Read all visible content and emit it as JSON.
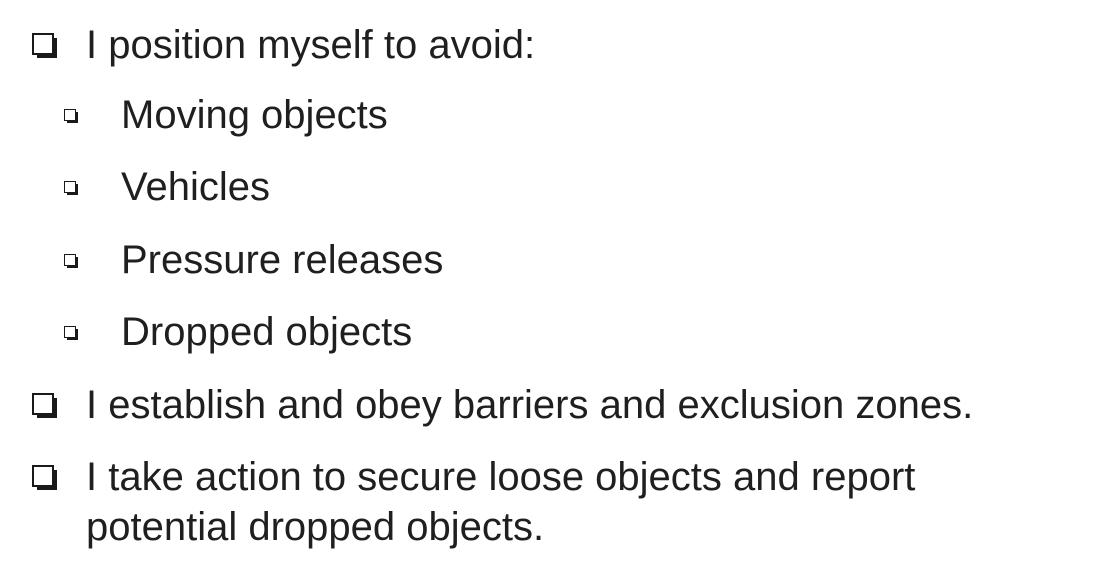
{
  "bullets": [
    {
      "text": "I position myself to avoid:",
      "subitems": [
        {
          "text": "Moving objects"
        },
        {
          "text": "Vehicles"
        },
        {
          "text": "Pressure releases"
        },
        {
          "text": "Dropped objects"
        }
      ]
    },
    {
      "text": "I establish and obey barriers and exclusion zones."
    },
    {
      "text": "I take action to secure loose objects and report potential dropped objects."
    }
  ],
  "icons": {
    "major_bullet": "hollow-square-shadow-icon",
    "minor_bullet": "small-hollow-square-shadow-icon"
  }
}
